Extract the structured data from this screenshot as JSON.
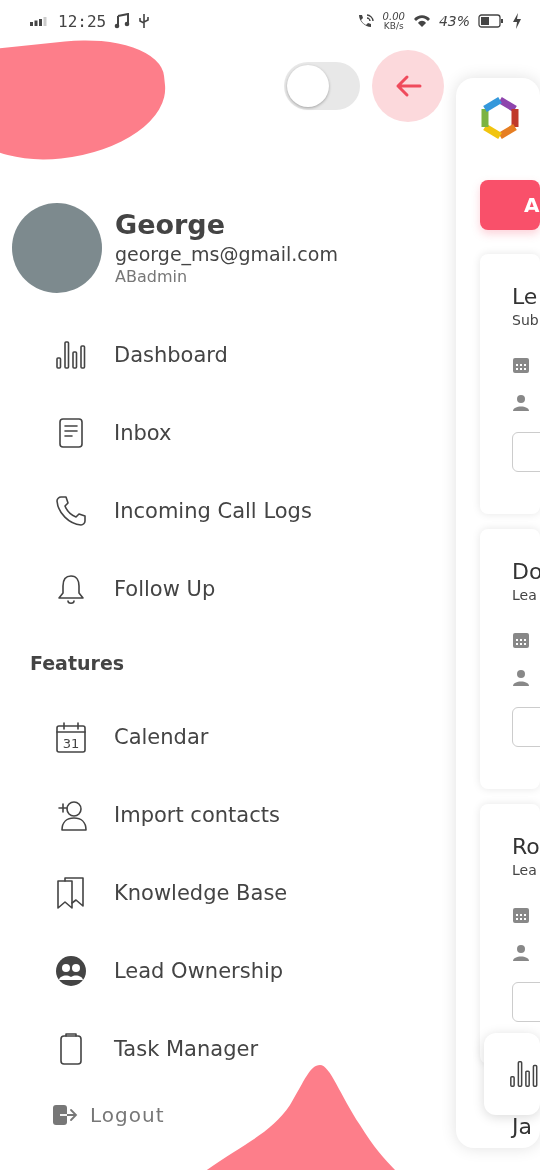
{
  "status_bar": {
    "time": "12:25",
    "net_speed": "0.00",
    "net_unit": "KB/s",
    "battery": "43%"
  },
  "theme_toggle": {
    "on": false
  },
  "profile": {
    "name": "George",
    "email": "george_ms@gmail.com",
    "role": "ABadmin"
  },
  "menu": [
    {
      "kind": "chart",
      "label": "Dashboard"
    },
    {
      "kind": "document",
      "label": "Inbox"
    },
    {
      "kind": "phone",
      "label": "Incoming Call Logs"
    },
    {
      "kind": "bell",
      "label": "Follow Up"
    }
  ],
  "features_heading": "Features",
  "features": [
    {
      "kind": "calendar",
      "label": "Calendar",
      "day": "31"
    },
    {
      "kind": "add-person",
      "label": "Import contacts"
    },
    {
      "kind": "bookmarks",
      "label": "Knowledge Base"
    },
    {
      "kind": "people",
      "label": "Lead Ownership"
    },
    {
      "kind": "clipboard",
      "label": "Task Manager"
    }
  ],
  "logout": "Logout",
  "background_screen": {
    "button_label": "A",
    "cards": [
      {
        "title": "Le",
        "subtitle": "Sub"
      },
      {
        "title": "Do",
        "subtitle": "Lea"
      },
      {
        "title": "Ro",
        "subtitle": "Lea"
      }
    ],
    "footer_text": "Ja"
  }
}
